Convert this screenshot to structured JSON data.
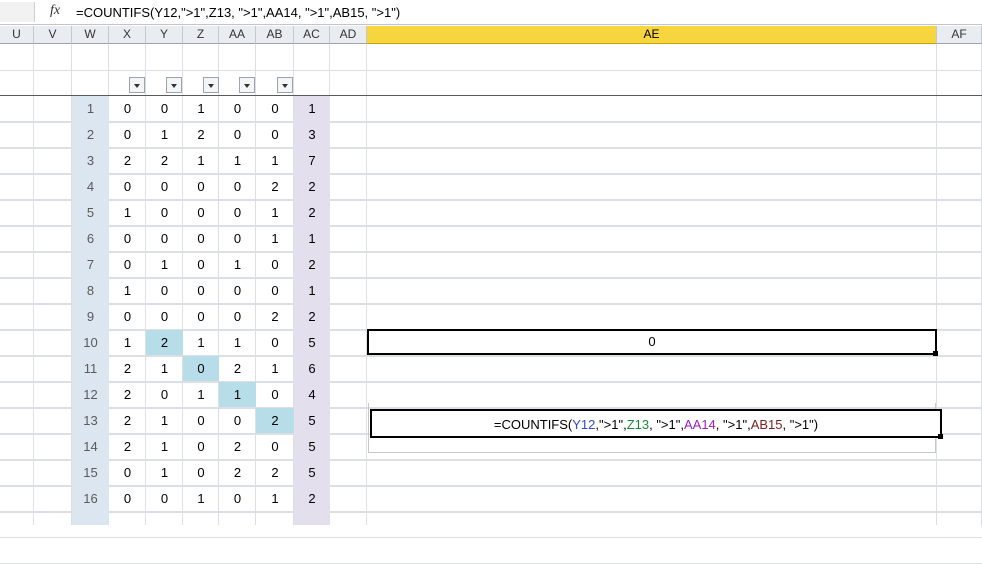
{
  "formula_bar": {
    "fx_label": "fx",
    "text": "=COUNTIFS(Y12,\">1\",Z13, \">1\",AA14, \">1\",AB15, \">1\")"
  },
  "columns": [
    "U",
    "V",
    "W",
    "X",
    "Y",
    "Z",
    "AA",
    "AB",
    "AC",
    "AD",
    "AE",
    "AF"
  ],
  "selected_column": "AE",
  "rows": [
    {
      "w": "1",
      "x": "0",
      "y": "0",
      "z": "1",
      "aa": "0",
      "ab": "0",
      "ac": "1"
    },
    {
      "w": "2",
      "x": "0",
      "y": "1",
      "z": "2",
      "aa": "0",
      "ab": "0",
      "ac": "3"
    },
    {
      "w": "3",
      "x": "2",
      "y": "2",
      "z": "1",
      "aa": "1",
      "ab": "1",
      "ac": "7"
    },
    {
      "w": "4",
      "x": "0",
      "y": "0",
      "z": "0",
      "aa": "0",
      "ab": "2",
      "ac": "2"
    },
    {
      "w": "5",
      "x": "1",
      "y": "0",
      "z": "0",
      "aa": "0",
      "ab": "1",
      "ac": "2"
    },
    {
      "w": "6",
      "x": "0",
      "y": "0",
      "z": "0",
      "aa": "0",
      "ab": "1",
      "ac": "1"
    },
    {
      "w": "7",
      "x": "0",
      "y": "1",
      "z": "0",
      "aa": "1",
      "ab": "0",
      "ac": "2"
    },
    {
      "w": "8",
      "x": "1",
      "y": "0",
      "z": "0",
      "aa": "0",
      "ab": "0",
      "ac": "1"
    },
    {
      "w": "9",
      "x": "0",
      "y": "0",
      "z": "0",
      "aa": "0",
      "ab": "2",
      "ac": "2"
    },
    {
      "w": "10",
      "x": "1",
      "y": "2",
      "z": "1",
      "aa": "1",
      "ab": "0",
      "ac": "5"
    },
    {
      "w": "11",
      "x": "2",
      "y": "1",
      "z": "0",
      "aa": "2",
      "ab": "1",
      "ac": "6"
    },
    {
      "w": "12",
      "x": "2",
      "y": "0",
      "z": "1",
      "aa": "1",
      "ab": "0",
      "ac": "4"
    },
    {
      "w": "13",
      "x": "2",
      "y": "1",
      "z": "0",
      "aa": "0",
      "ab": "2",
      "ac": "5"
    },
    {
      "w": "14",
      "x": "2",
      "y": "1",
      "z": "0",
      "aa": "2",
      "ab": "0",
      "ac": "5"
    },
    {
      "w": "15",
      "x": "0",
      "y": "1",
      "z": "0",
      "aa": "2",
      "ab": "2",
      "ac": "5"
    },
    {
      "w": "16",
      "x": "0",
      "y": "0",
      "z": "1",
      "aa": "0",
      "ab": "1",
      "ac": "2"
    }
  ],
  "result_cell": {
    "value": "0"
  },
  "formula_display": {
    "p1": "=COUNTIFS(",
    "ref_y": "Y12",
    "p2": ",\">1\",",
    "ref_z": "Z13",
    "p3": ", \">1\",",
    "ref_aa": "AA14",
    "p4": ", \">1\",",
    "ref_ab": "AB15",
    "p5": ", \">1\")"
  },
  "colors": {
    "header_bg": "#e9edf2",
    "selected_header": "#f7d53f",
    "w_band": "#dce6f1",
    "ac_band": "#e4dfec",
    "diag_highlight": "#b7dde8"
  }
}
